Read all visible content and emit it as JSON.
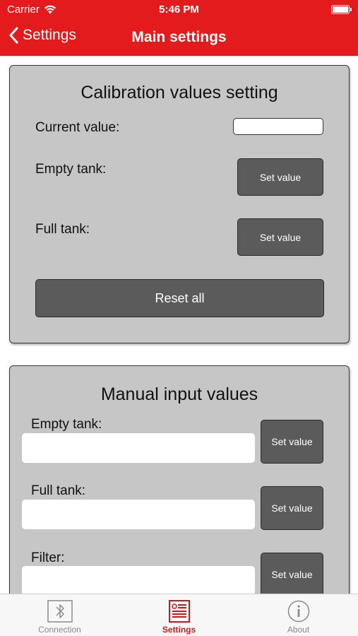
{
  "status_bar": {
    "carrier": "Carrier",
    "time": "5:46 PM"
  },
  "nav": {
    "back_label": "Settings",
    "title": "Main settings"
  },
  "calibration": {
    "title": "Calibration values setting",
    "current_value_label": "Current value:",
    "current_value": "",
    "empty_tank_label": "Empty tank:",
    "full_tank_label": "Full tank:",
    "set_value_label": "Set value",
    "reset_label": "Reset all"
  },
  "manual": {
    "title": "Manual input values",
    "empty_tank_label": "Empty tank:",
    "full_tank_label": "Full tank:",
    "filter_label": "Filter:",
    "empty_tank_value": "",
    "full_tank_value": "",
    "filter_value": "",
    "set_value_label": "Set value"
  },
  "tabs": [
    {
      "label": "Connection",
      "icon": "bluetooth-icon"
    },
    {
      "label": "Settings",
      "icon": "settings-document-icon"
    },
    {
      "label": "About",
      "icon": "info-icon"
    }
  ],
  "colors": {
    "accent": "#e31b1c",
    "panel": "#c6c6c6",
    "button": "#5b5b5b",
    "active_tab": "#d4161c"
  }
}
